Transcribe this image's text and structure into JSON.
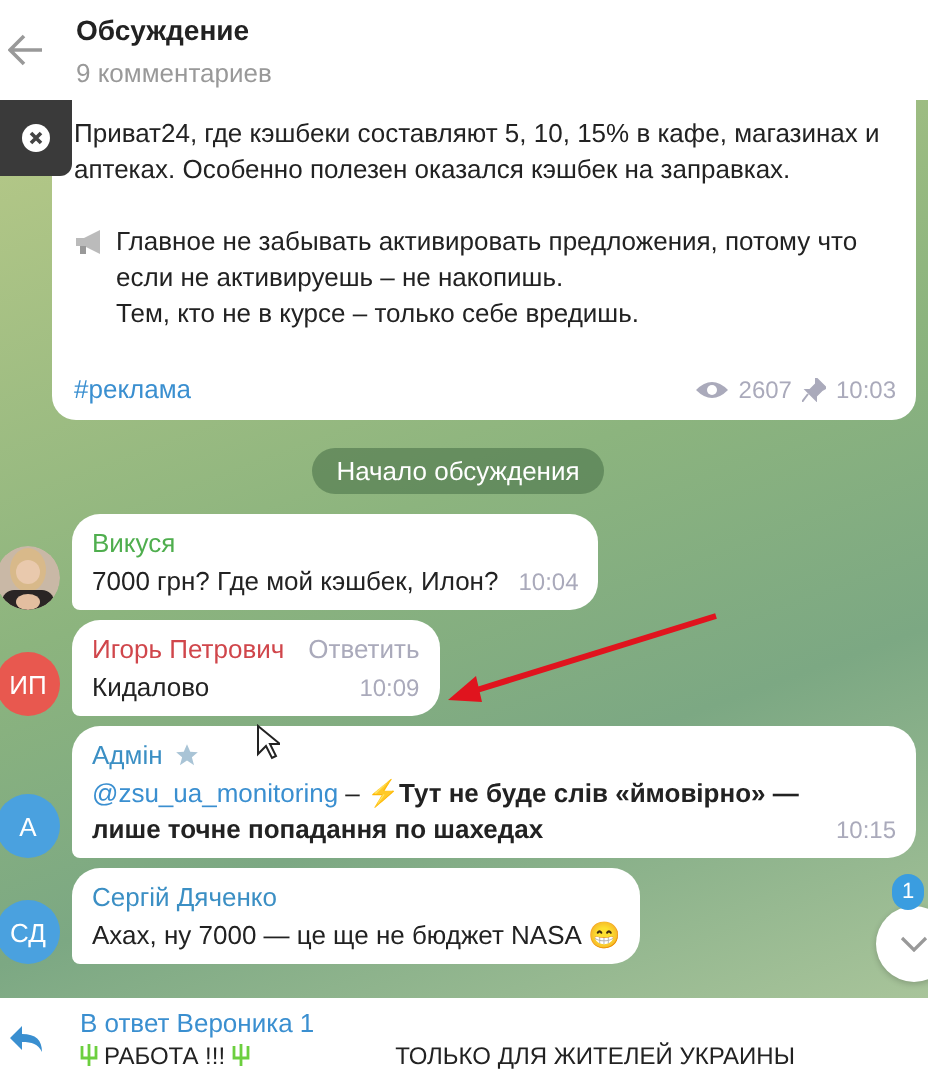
{
  "header": {
    "title": "Обсуждение",
    "subtitle": "9 комментариев"
  },
  "post": {
    "paragraphs": [
      "Приват24, где кэшбеки составляют 5, 10, 15% в кафе, магазинах и аптеках. Особенно полезен оказался кэшбек на заправках.",
      "Главное не забывать активировать предложения, потому что если не активируешь – не накопишь.\nТем, кто не в курсе – только себе вредишь."
    ],
    "hashtag": "#реклама",
    "views": "2607",
    "time": "10:03"
  },
  "divider": "Начало обсуждения",
  "comments": [
    {
      "author": "Викуся",
      "color": "#4fae4e",
      "text": "7000 грн? Где мой кэшбек, Илон?",
      "time": "10:04"
    },
    {
      "author": "Игорь Петрович",
      "color": "#d0464b",
      "avatar": {
        "kind": "initials",
        "initials": "ИП",
        "color": "#e8584f"
      },
      "action": "Ответить",
      "text": "Кидалово",
      "time": "10:09"
    },
    {
      "author": "Адмін",
      "color": "#3b8fc4",
      "admin": true,
      "avatar": {
        "kind": "initials",
        "initials": "А",
        "color": "#4aa1df"
      },
      "mention": "@zsu_ua_monitoring",
      "text": "– ⚡**Тут не буде слів «ймовірно» — лише точне попадання по шахедах**",
      "time": "10:15"
    },
    {
      "author": "Сергій Дяченко",
      "color": "#3b8fc4",
      "avatar": {
        "kind": "initials",
        "initials": "СД",
        "color": "#4aa1df"
      },
      "text": "Ахах, ну 7000 — це ще не бюджет NASA 😁"
    }
  ],
  "scroll_button": {
    "badge": "1"
  },
  "reply_bar": {
    "label": "В ответ Вероника 1",
    "preview": [
      "РАБОТА !!!",
      "ТОЛЬКО ДЛЯ ЖИТЕЛЕЙ УКРАИНЫ"
    ]
  }
}
